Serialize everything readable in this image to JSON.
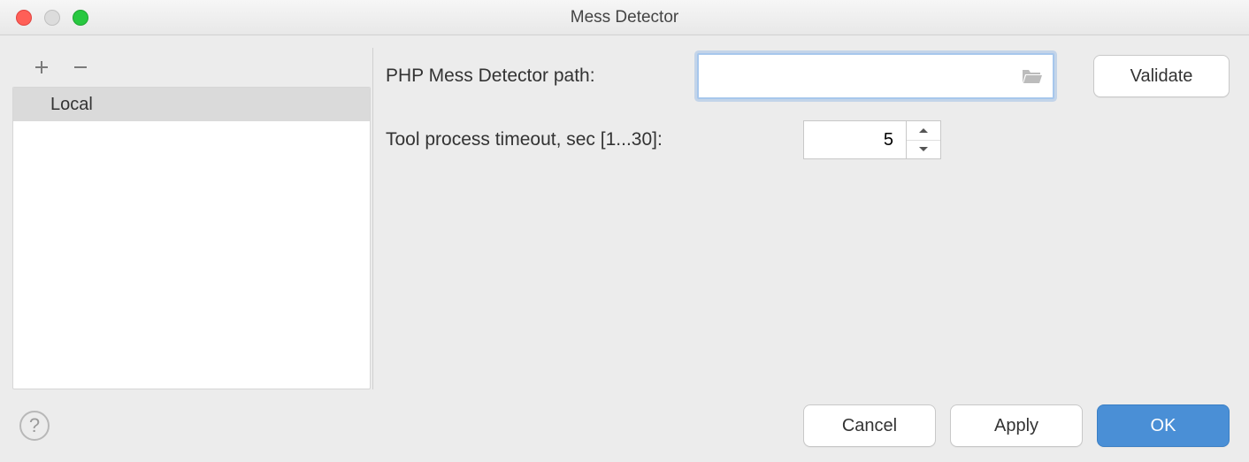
{
  "window": {
    "title": "Mess Detector"
  },
  "sidebar": {
    "items": [
      {
        "label": "Local",
        "selected": true
      }
    ]
  },
  "form": {
    "path_label": "PHP Mess Detector path:",
    "path_value": "",
    "validate_label": "Validate",
    "timeout_label": "Tool process timeout, sec [1...30]:",
    "timeout_value": "5"
  },
  "footer": {
    "cancel": "Cancel",
    "apply": "Apply",
    "ok": "OK"
  }
}
